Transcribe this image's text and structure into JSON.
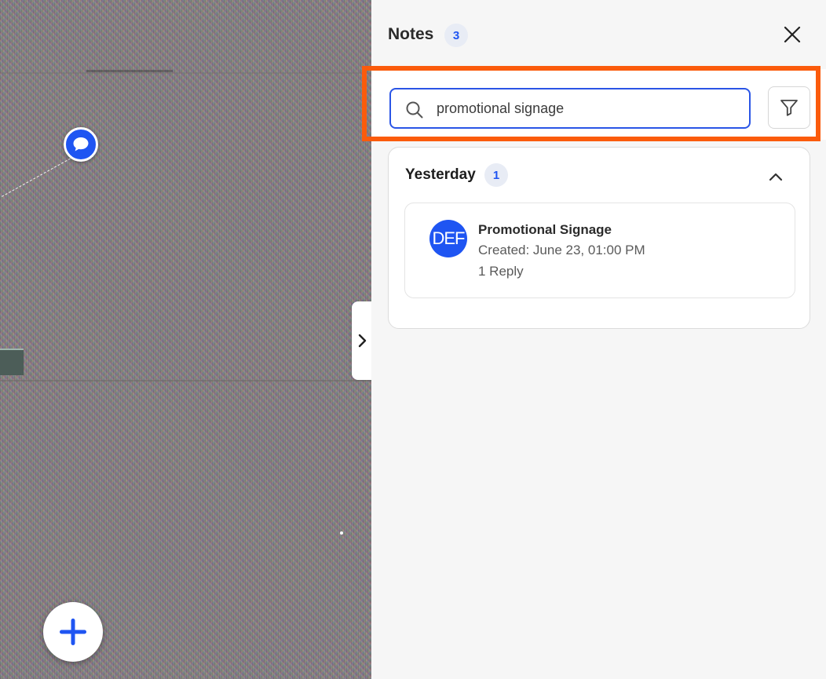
{
  "panel": {
    "title": "Notes",
    "count": "3"
  },
  "search": {
    "value": "promotional signage",
    "placeholder": ""
  },
  "group": {
    "title": "Yesterday",
    "count": "1"
  },
  "note": {
    "avatar_initials": "DEF",
    "title": "Promotional Signage",
    "created": "Created: June 23, 01:00 PM",
    "replies": "1 Reply"
  },
  "colors": {
    "accent": "#1f55f2",
    "highlight": "#fb5b0c"
  },
  "icons": {
    "close": "close-icon",
    "search": "search-icon",
    "filter": "filter-icon",
    "collapse_group": "chevron-up-icon",
    "collapse_panel": "chevron-right-icon",
    "add": "plus-icon",
    "note_pin": "chat-bubble-icon"
  }
}
